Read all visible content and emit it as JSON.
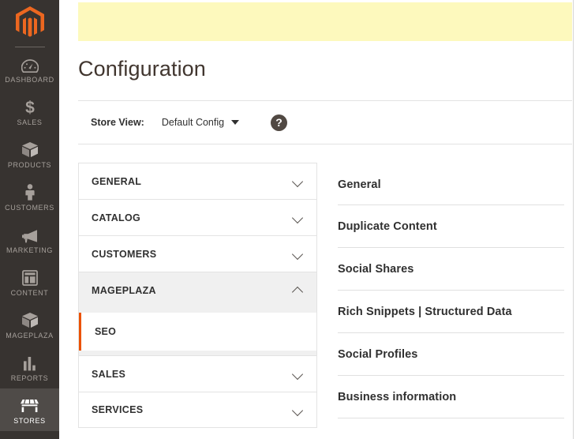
{
  "admin_nav": {
    "logo": "magento-logo",
    "items": [
      {
        "label": "DASHBOARD",
        "icon": "dashboard-gauge-icon",
        "active": false
      },
      {
        "label": "SALES",
        "icon": "dollar-sign-icon",
        "active": false
      },
      {
        "label": "PRODUCTS",
        "icon": "box-icon",
        "active": false
      },
      {
        "label": "CUSTOMERS",
        "icon": "person-icon",
        "active": false
      },
      {
        "label": "MARKETING",
        "icon": "megaphone-icon",
        "active": false
      },
      {
        "label": "CONTENT",
        "icon": "layout-page-icon",
        "active": false
      },
      {
        "label": "MAGEPLAZA",
        "icon": "box-icon",
        "active": false
      },
      {
        "label": "REPORTS",
        "icon": "bar-chart-icon",
        "active": false
      },
      {
        "label": "STORES",
        "icon": "storefront-icon",
        "active": true
      }
    ]
  },
  "banner": {
    "text": ""
  },
  "header": {
    "title": "Configuration"
  },
  "store_switcher": {
    "label": "Store View:",
    "selected": "Default Config",
    "caret_icon": "chevron-down-icon",
    "help_icon": "question-mark-icon",
    "help_glyph": "?"
  },
  "config_nav": {
    "sections": [
      {
        "title": "GENERAL",
        "expanded": false,
        "chevron": "chevron-down-icon"
      },
      {
        "title": "CATALOG",
        "expanded": false,
        "chevron": "chevron-down-icon"
      },
      {
        "title": "CUSTOMERS",
        "expanded": false,
        "chevron": "chevron-down-icon"
      },
      {
        "title": "MAGEPLAZA",
        "expanded": true,
        "chevron": "chevron-up-icon"
      },
      {
        "title": "SALES",
        "expanded": false,
        "chevron": "chevron-down-icon"
      },
      {
        "title": "SERVICES",
        "expanded": false,
        "chevron": "chevron-down-icon"
      }
    ],
    "mageplaza_children": [
      {
        "label": "SEO",
        "active": true
      }
    ]
  },
  "section_list": {
    "items": [
      {
        "label": "General"
      },
      {
        "label": "Duplicate Content"
      },
      {
        "label": "Social Shares"
      },
      {
        "label": "Rich Snippets | Structured Data"
      },
      {
        "label": "Social Profiles"
      },
      {
        "label": "Business information"
      }
    ]
  },
  "colors": {
    "nav_bg": "#373330",
    "nav_active_bg": "#4f4b48",
    "brand_orange": "#eb5202",
    "banner_yellow": "#fdf9bd",
    "accordion_expanded_bg": "#f0f0f0",
    "text_dark": "#303030"
  }
}
